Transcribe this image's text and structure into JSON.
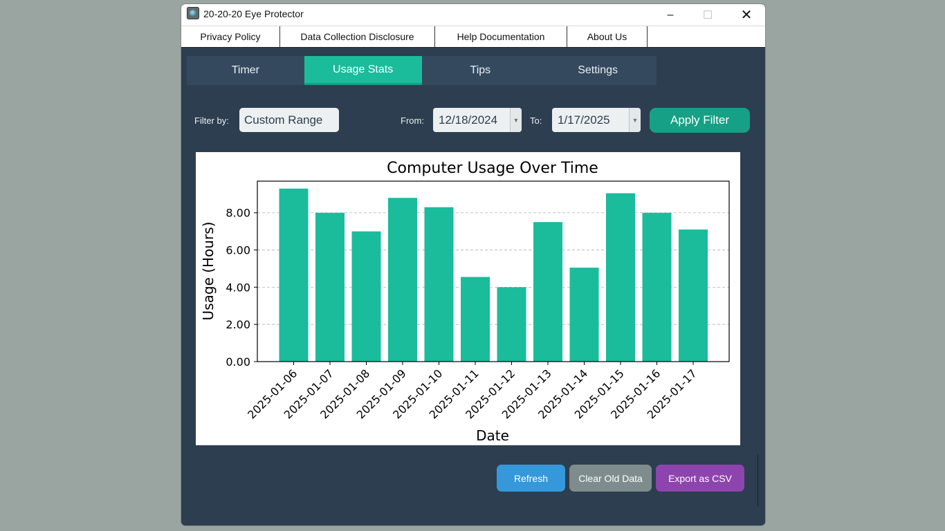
{
  "window": {
    "title": "20-20-20 Eye Protector",
    "minimize": "–",
    "maximize": "☐",
    "close": "✕"
  },
  "menu": [
    {
      "label": "Privacy Policy"
    },
    {
      "label": "Data Collection Disclosure"
    },
    {
      "label": "Help Documentation"
    },
    {
      "label": "About Us"
    }
  ],
  "tabs": [
    {
      "label": "Timer"
    },
    {
      "label": "Usage Stats",
      "active": true
    },
    {
      "label": "Tips"
    },
    {
      "label": "Settings"
    }
  ],
  "filter": {
    "label": "Filter by:",
    "selected": "Custom Range",
    "from_label": "From:",
    "from_value": "12/18/2024",
    "to_label": "To:",
    "to_value": "1/17/2025",
    "apply_label": "Apply Filter"
  },
  "chart_data": {
    "type": "bar",
    "title": "Computer Usage Over Time",
    "xlabel": "Date",
    "ylabel": "Usage (Hours)",
    "categories": [
      "2025-01-06",
      "2025-01-07",
      "2025-01-08",
      "2025-01-09",
      "2025-01-10",
      "2025-01-11",
      "2025-01-12",
      "2025-01-13",
      "2025-01-14",
      "2025-01-15",
      "2025-01-16",
      "2025-01-17"
    ],
    "values": [
      9.3,
      8.0,
      7.0,
      8.8,
      8.3,
      4.55,
      4.0,
      7.5,
      5.05,
      9.05,
      8.0,
      7.1
    ],
    "yticks": [
      "0.00",
      "2.00",
      "4.00",
      "6.00",
      "8.00"
    ],
    "ylim": [
      0,
      9.7
    ],
    "grid": "horizontal dashed",
    "color": "#1abc9c"
  },
  "actions": {
    "refresh": "Refresh",
    "clear": "Clear Old Data",
    "export": "Export as CSV"
  },
  "colors": {
    "background": "#2d3e50",
    "accent": "#1abc9c",
    "refresh": "#3498db",
    "clear": "#7f8c8d",
    "export": "#8e44ad"
  }
}
